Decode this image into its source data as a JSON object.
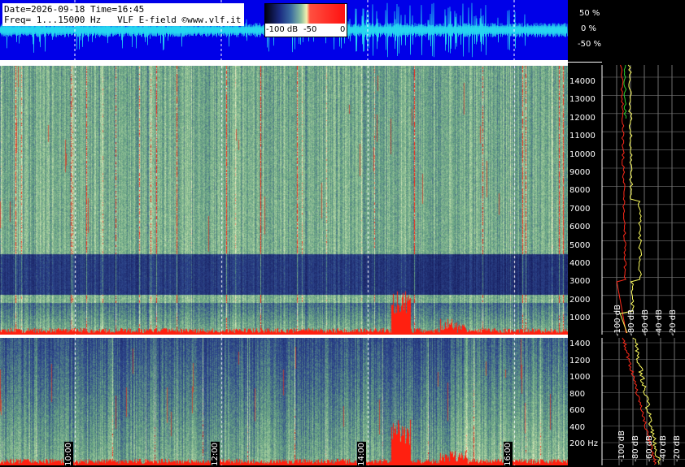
{
  "header": {
    "date_line": "Date=2026-09-18 Time=16:45",
    "freq_line": "Freq= 1...15000 Hz   VLF E-field ©www.vlf.it"
  },
  "colorbar": {
    "label_min": "-100 dB",
    "label_mid": "-50",
    "label_max": "0"
  },
  "waveform": {
    "pct_top": "50 %",
    "pct_mid": "0 %",
    "pct_bot": "-50 %"
  },
  "top_freq_axis": [
    "14000",
    "13000",
    "12000",
    "11000",
    "10000",
    "9000",
    "8000",
    "7000",
    "6000",
    "5000",
    "4000",
    "3000",
    "2000",
    "1000"
  ],
  "bottom_freq_axis": [
    "1400",
    "1200",
    "1000",
    "800",
    "600",
    "400",
    "200 Hz"
  ],
  "time_labels": [
    "10:00",
    "12:00",
    "14:00",
    "16:00"
  ],
  "db_labels_top": [
    "-100 dB",
    "-80 dB",
    "-60 dB",
    "-40 dB",
    "-20 dB"
  ],
  "db_labels_bottom": [
    "-100 dB",
    "-80 dB",
    "-60 dB",
    "-40 dB",
    "-20 dB"
  ],
  "colors": {
    "waveform_bg": "#0000e8",
    "waveform_trace": "#00e0ff",
    "spectrum_low": "#1c2a78",
    "spectrum_mid": "#6fa886",
    "spectrum_high": "#ff2010",
    "profile_red": "#ff2a1a",
    "profile_yellow": "#ffff60",
    "profile_green": "#30d030"
  }
}
